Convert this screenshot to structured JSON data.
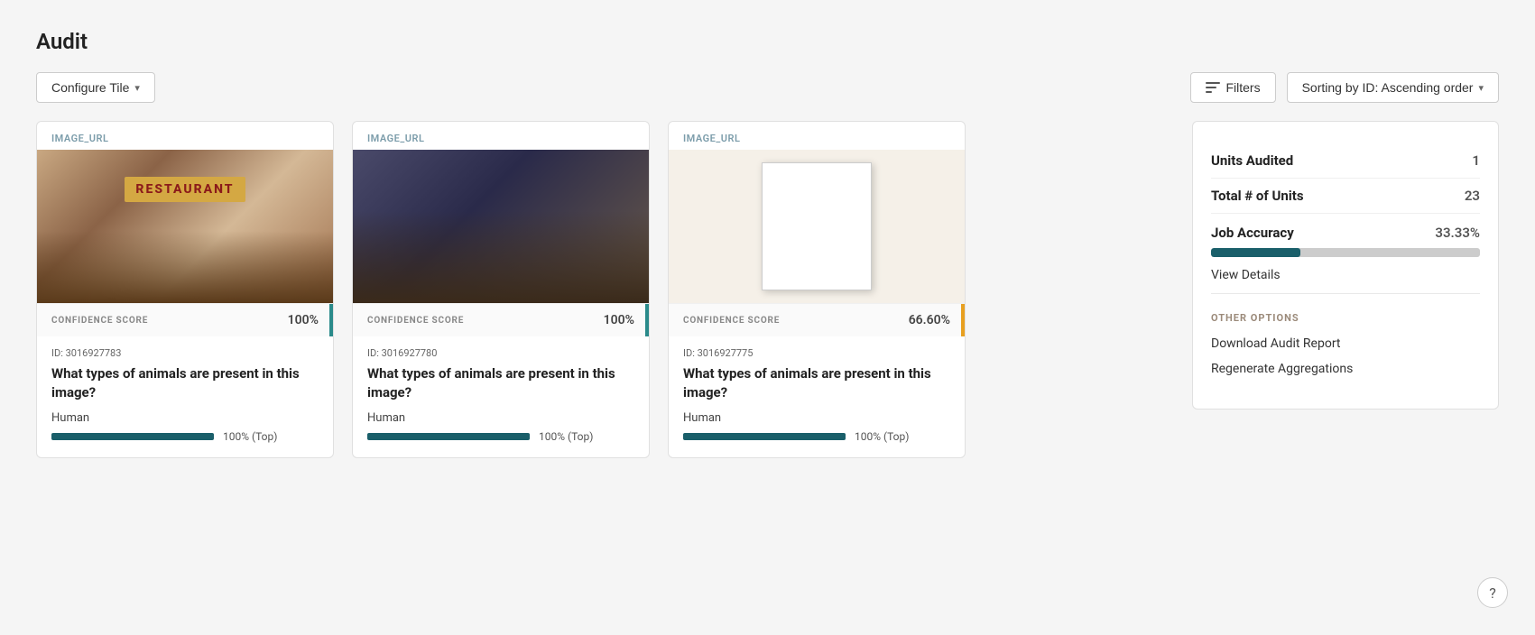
{
  "page": {
    "title": "Audit"
  },
  "toolbar": {
    "configure_tile_label": "Configure Tile",
    "filters_label": "Filters",
    "sorting_label": "Sorting by ID: Ascending order"
  },
  "cards": [
    {
      "id": "card-1",
      "image_label": "IMAGE_URL",
      "image_type": "restaurant",
      "confidence_label": "CONFIDENCE SCORE",
      "confidence_score": "100%",
      "stripe_color": "teal",
      "item_id": "ID: 3016927783",
      "question": "What types of animals are present in this image?",
      "answer": "Human",
      "answer_bar_pct": "100% (Top)",
      "answer_bar_width": "100"
    },
    {
      "id": "card-2",
      "image_label": "IMAGE_URL",
      "image_type": "cafe",
      "confidence_label": "CONFIDENCE SCORE",
      "confidence_score": "100%",
      "stripe_color": "teal",
      "item_id": "ID: 3016927780",
      "question": "What types of animals are present in this image?",
      "answer": "Human",
      "answer_bar_pct": "100% (Top)",
      "answer_bar_width": "100"
    },
    {
      "id": "card-3",
      "image_label": "IMAGE_URL",
      "image_type": "menu",
      "confidence_label": "CONFIDENCE SCORE",
      "confidence_score": "66.60%",
      "stripe_color": "orange",
      "item_id": "ID: 3016927775",
      "question": "What types of animals are present in this image?",
      "answer": "Human",
      "answer_bar_pct": "100% (Top)",
      "answer_bar_width": "100"
    }
  ],
  "sidebar": {
    "units_audited_label": "Units Audited",
    "units_audited_value": "1",
    "total_units_label": "Total # of Units",
    "total_units_value": "23",
    "job_accuracy_label": "Job Accuracy",
    "job_accuracy_value": "33.33%",
    "job_accuracy_pct": 33.33,
    "view_details_label": "View Details",
    "other_options_title": "OTHER OPTIONS",
    "download_label": "Download Audit Report",
    "regenerate_label": "Regenerate Aggregations"
  },
  "help": {
    "label": "?"
  }
}
